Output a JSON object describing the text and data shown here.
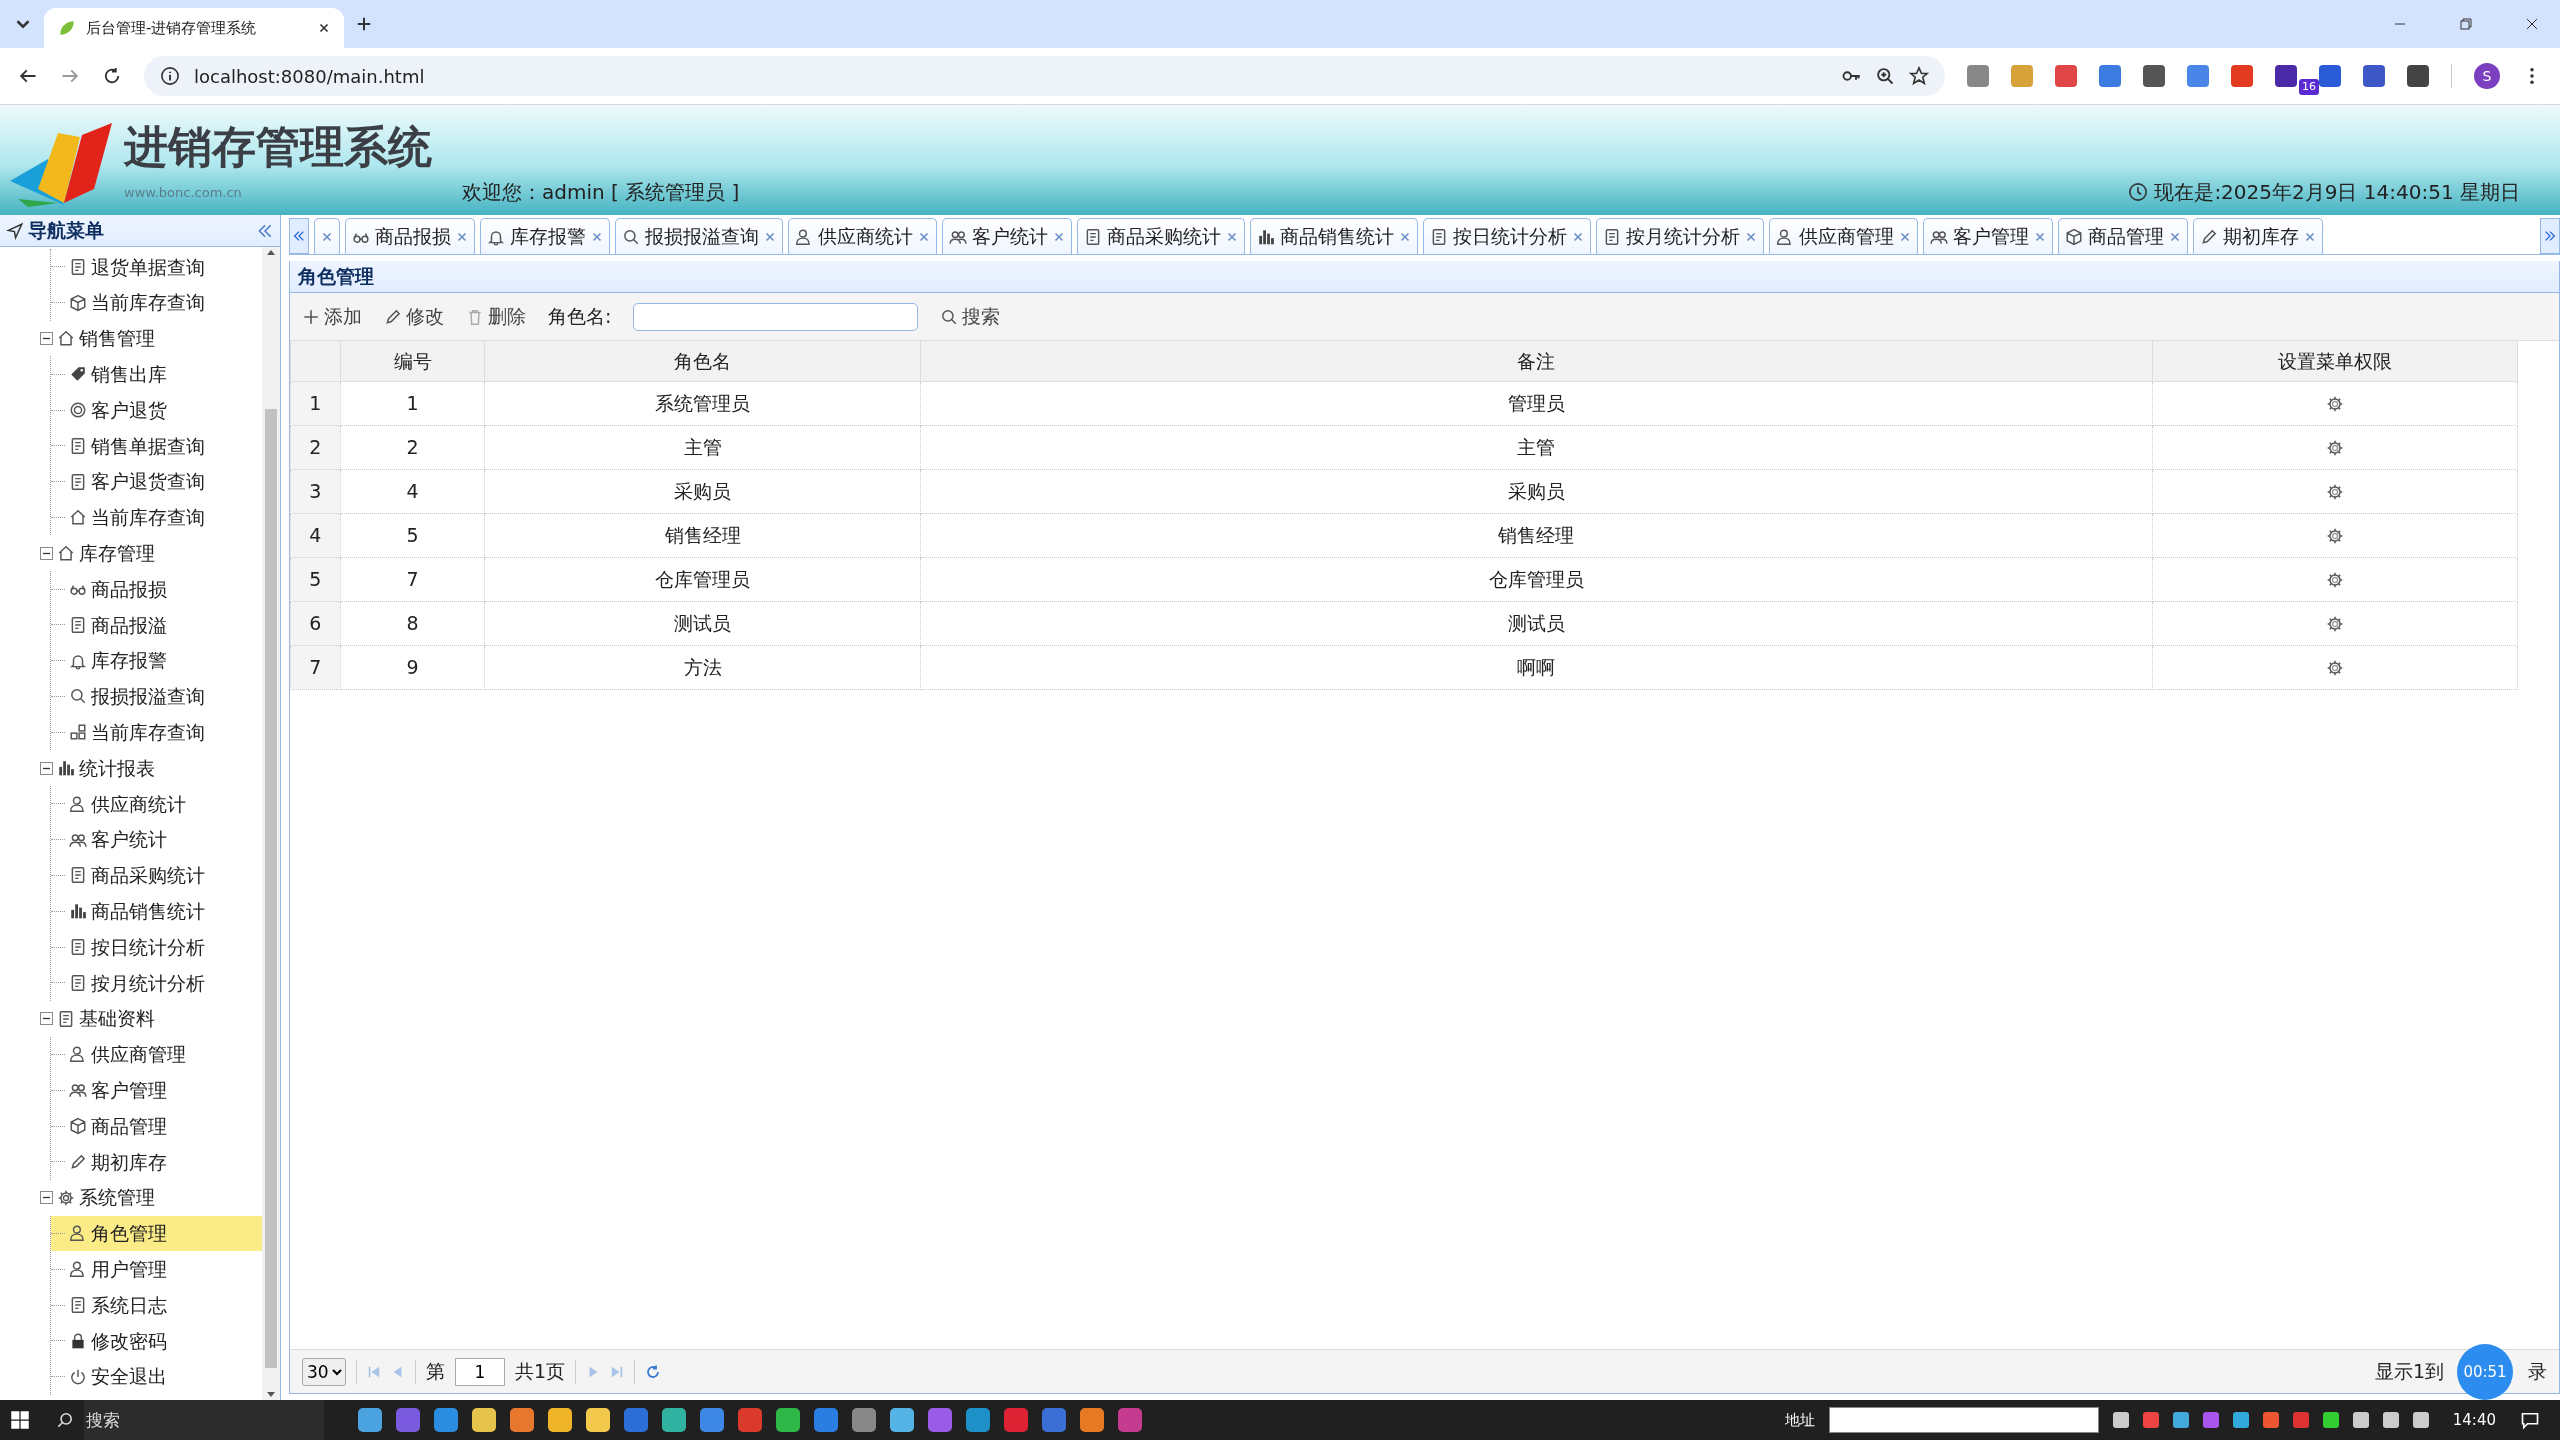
{
  "browser": {
    "tab_title": "后台管理-进销存管理系统",
    "url": "localhost:8080/main.html",
    "extension_badge": "16",
    "profile_initial": "S"
  },
  "header": {
    "title": "进销存管理系统",
    "site": "www.bonc.com.cn",
    "welcome": "欢迎您：admin [ 系统管理员 ]",
    "clock": "现在是:2025年2月9日 14:40:51 星期日"
  },
  "sidebar": {
    "title": "导航菜单",
    "items": [
      {
        "children": [
          {
            "label": "退货单据查询",
            "selected": false
          },
          {
            "label": "当前库存查询",
            "selected": false
          }
        ]
      },
      {
        "label": "销售管理",
        "expanded": true,
        "children": [
          {
            "label": "销售出库",
            "selected": false
          },
          {
            "label": "客户退货",
            "selected": false
          },
          {
            "label": "销售单据查询",
            "selected": false
          },
          {
            "label": "客户退货查询",
            "selected": false
          },
          {
            "label": "当前库存查询",
            "selected": false
          }
        ]
      },
      {
        "label": "库存管理",
        "expanded": true,
        "children": [
          {
            "label": "商品报损",
            "selected": false
          },
          {
            "label": "商品报溢",
            "selected": false
          },
          {
            "label": "库存报警",
            "selected": false
          },
          {
            "label": "报损报溢查询",
            "selected": false
          },
          {
            "label": "当前库存查询",
            "selected": false
          }
        ]
      },
      {
        "label": "统计报表",
        "expanded": true,
        "children": [
          {
            "label": "供应商统计",
            "selected": false
          },
          {
            "label": "客户统计",
            "selected": false
          },
          {
            "label": "商品采购统计",
            "selected": false
          },
          {
            "label": "商品销售统计",
            "selected": false
          },
          {
            "label": "按日统计分析",
            "selected": false
          },
          {
            "label": "按月统计分析",
            "selected": false
          }
        ]
      },
      {
        "label": "基础资料",
        "expanded": true,
        "children": [
          {
            "label": "供应商管理",
            "selected": false
          },
          {
            "label": "客户管理",
            "selected": false
          },
          {
            "label": "商品管理",
            "selected": false
          },
          {
            "label": "期初库存",
            "selected": false
          }
        ]
      },
      {
        "label": "系统管理",
        "expanded": true,
        "children": [
          {
            "label": "角色管理",
            "selected": true
          },
          {
            "label": "用户管理",
            "selected": false
          },
          {
            "label": "系统日志",
            "selected": false
          },
          {
            "label": "修改密码",
            "selected": false
          },
          {
            "label": "安全退出",
            "selected": false
          }
        ]
      }
    ]
  },
  "tabs": [
    {
      "selected": false
    },
    {
      "label": "商品报损",
      "selected": false
    },
    {
      "label": "库存报警",
      "selected": false
    },
    {
      "label": "报损报溢查询",
      "selected": false
    },
    {
      "label": "供应商统计",
      "selected": false
    },
    {
      "label": "客户统计",
      "selected": false
    },
    {
      "label": "商品采购统计",
      "selected": false
    },
    {
      "label": "商品销售统计",
      "selected": false
    },
    {
      "label": "按日统计分析",
      "selected": false
    },
    {
      "label": "按月统计分析",
      "selected": false
    },
    {
      "label": "供应商管理",
      "selected": false
    },
    {
      "label": "客户管理",
      "selected": false
    },
    {
      "label": "商品管理",
      "selected": false
    },
    {
      "label": "期初库存",
      "selected": false
    }
  ],
  "panel": {
    "title": "角色管理",
    "toolbar": [
      {
        "kind": "add",
        "label": "添加"
      },
      {
        "kind": "edit",
        "label": "修改"
      },
      {
        "kind": "delete",
        "label": "删除"
      }
    ],
    "search_label": "角色名:",
    "search_button": "搜索"
  },
  "table": {
    "columns": [
      "编号",
      "角色名",
      "备注",
      "设置菜单权限"
    ],
    "rows": [
      {
        "row": "1",
        "id": "1",
        "name": "系统管理员",
        "remark": "管理员"
      },
      {
        "row": "2",
        "id": "2",
        "name": "主管",
        "remark": "主管"
      },
      {
        "row": "3",
        "id": "4",
        "name": "采购员",
        "remark": "采购员"
      },
      {
        "row": "4",
        "id": "5",
        "name": "销售经理",
        "remark": "销售经理"
      },
      {
        "row": "5",
        "id": "7",
        "name": "仓库管理员",
        "remark": "仓库管理员"
      },
      {
        "row": "6",
        "id": "8",
        "name": "测试员",
        "remark": "测试员"
      },
      {
        "row": "7",
        "id": "9",
        "name": "方法",
        "remark": "啊啊"
      }
    ]
  },
  "pager": {
    "page_size": "30",
    "page_label": "第",
    "page": "1",
    "total_pages": "共1页",
    "summary_start": "显示1到",
    "summary_end": "录"
  },
  "timer": "00:51",
  "taskbar": {
    "search_placeholder": "搜索",
    "address_label": "地址",
    "time": "14:40"
  }
}
